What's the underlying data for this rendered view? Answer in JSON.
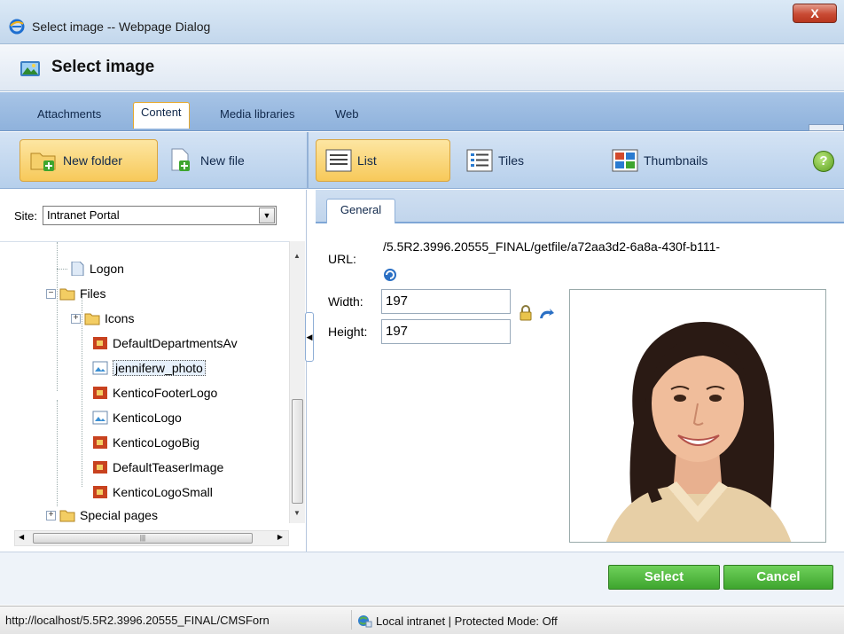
{
  "window": {
    "title": "Select image -- Webpage Dialog",
    "close": "X"
  },
  "dialog": {
    "title": "Select image"
  },
  "tabs": [
    {
      "label": "Attachments",
      "active": false
    },
    {
      "label": "Content",
      "active": true
    },
    {
      "label": "Media libraries",
      "active": false
    },
    {
      "label": "Web",
      "active": false
    }
  ],
  "toolbar": {
    "new_folder": "New folder",
    "new_file": "New file",
    "list": "List",
    "tiles": "Tiles",
    "thumbnails": "Thumbnails",
    "help": "?"
  },
  "site": {
    "label": "Site:",
    "value": "Intranet Portal"
  },
  "tree": [
    {
      "label": "Logon",
      "icon": "page-icon"
    },
    {
      "label": "Files",
      "icon": "folder-icon"
    },
    {
      "label": "Icons",
      "icon": "folder-icon"
    },
    {
      "label": "DefaultDepartmentsAv",
      "icon": "image-file-icon"
    },
    {
      "label": "jenniferw_photo",
      "icon": "image-file-icon",
      "selected": true
    },
    {
      "label": "KenticoFooterLogo",
      "icon": "image-file-icon"
    },
    {
      "label": "KenticoLogo",
      "icon": "image-file-icon"
    },
    {
      "label": "KenticoLogoBig",
      "icon": "image-file-icon"
    },
    {
      "label": "DefaultTeaserImage",
      "icon": "image-file-icon"
    },
    {
      "label": "KenticoLogoSmall",
      "icon": "image-file-icon"
    },
    {
      "label": "Special pages",
      "icon": "folder-icon"
    }
  ],
  "properties": {
    "tab": "General",
    "url_label": "URL:",
    "url_value": "/5.5R2.3996.20555_FINAL/getfile/a72aa3d2-6a8a-430f-b111-",
    "width_label": "Width:",
    "width_value": "197",
    "height_label": "Height:",
    "height_value": "197"
  },
  "buttons": {
    "select": "Select",
    "cancel": "Cancel"
  },
  "statusbar": {
    "url": "http://localhost/5.5R2.3996.20555_FINAL/CMSForn",
    "zone": "Local intranet | Protected Mode: Off"
  },
  "colors": {
    "accent_orange": "#f7c95a",
    "button_green": "#3ea52e",
    "tab_blue": "#8fb2dc"
  }
}
